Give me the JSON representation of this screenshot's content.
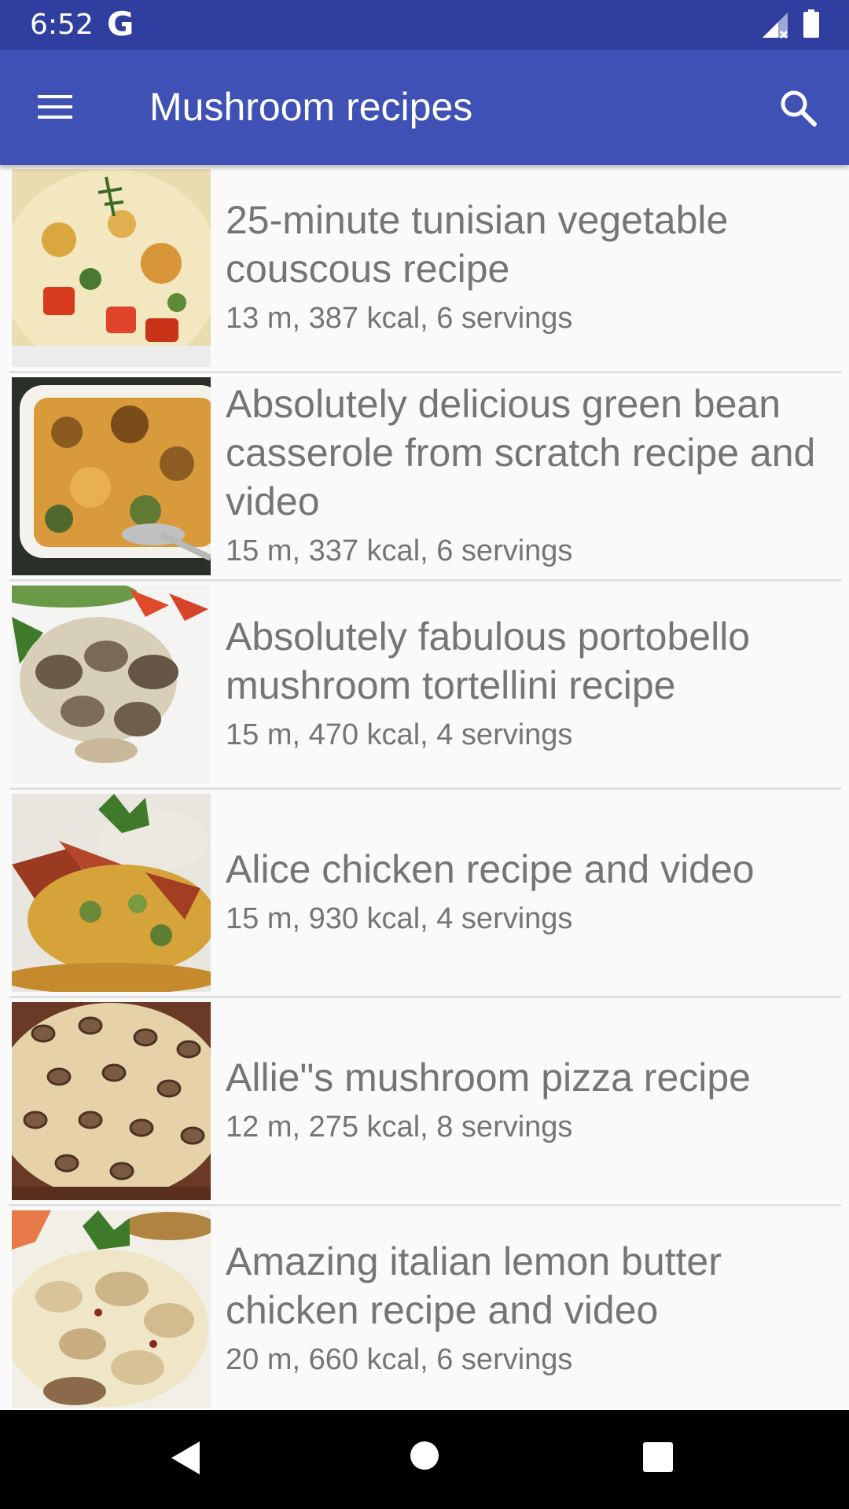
{
  "status_bar": {
    "time": "6:52",
    "g_label": "G"
  },
  "app_bar": {
    "title": "Mushroom recipes",
    "menu_icon": "hamburger-menu-icon",
    "search_icon": "search-icon",
    "background_color": "#3f51b5",
    "status_color": "#303f9f"
  },
  "recipes": [
    {
      "title": "25-minute tunisian vegetable couscous recipe",
      "meta": "13 m, 387 kcal, 6 servings",
      "image_icon": "couscous-photo"
    },
    {
      "title": "Absolutely delicious green bean casserole from scratch recipe and video",
      "meta": "15 m, 337 kcal, 6 servings",
      "image_icon": "casserole-photo"
    },
    {
      "title": "Absolutely fabulous portobello mushroom tortellini recipe",
      "meta": "15 m, 470 kcal, 4 servings",
      "image_icon": "tortellini-photo"
    },
    {
      "title": "Alice chicken recipe and video",
      "meta": "15 m, 930 kcal, 4 servings",
      "image_icon": "chicken-photo"
    },
    {
      "title": "Allie\"s mushroom pizza recipe",
      "meta": "12 m, 275 kcal, 8 servings",
      "image_icon": "pizza-photo"
    },
    {
      "title": "Amazing italian lemon butter chicken recipe and video",
      "meta": "20 m, 660 kcal, 6 servings",
      "image_icon": "lemon-chicken-photo"
    }
  ],
  "nav_bar": {
    "back_icon": "back-triangle-icon",
    "home_icon": "home-circle-icon",
    "recents_icon": "recents-square-icon"
  }
}
